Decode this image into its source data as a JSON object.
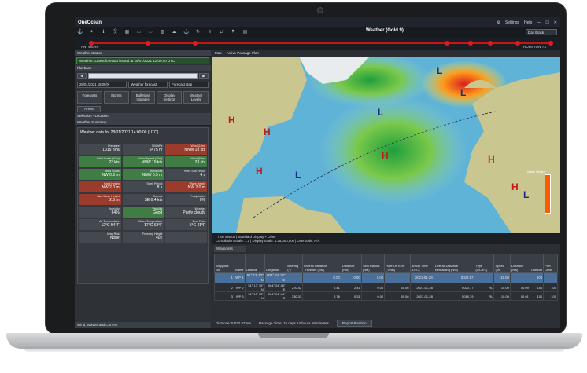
{
  "app": {
    "name": "OneOcean",
    "route_title": "Weather (Gold 9)",
    "day_select": "Day Black",
    "settings": "Settings",
    "help": "Help"
  },
  "timeline": {
    "start": "ANTWERP",
    "end": "HOUSTON TX"
  },
  "left": {
    "weather_status": "Weather Status",
    "latest_forecast": "Weather: Latest forecast issued at 28/01/2021 12:00:00 UTC",
    "playback": "Playback",
    "date_value": "28/01/2021 18:00(X",
    "weather_forecast": "Weather forecast",
    "forecast_step": "Forecast step",
    "tabs": [
      "Forecasts",
      "Storms",
      "Bulletins/ Updates",
      "Display Settings",
      "Weather Levels"
    ],
    "areas": "Areas",
    "selection": "Selection - Location",
    "summary_title": "Weather Summary",
    "weather_data_for": "Weather data for 28/01/2021 14:00:00 (UTC)",
    "wind_waves": "Wind, Waves and Current"
  },
  "summary_rows": [
    [
      {
        "label": "Pressure",
        "value": "1015 hPa",
        "c": "d"
      },
      {
        "label": "500 hPa",
        "value": "5475 m",
        "c": "d"
      },
      {
        "label": "Wind (10m)",
        "value": "NNW 18 kts",
        "c": "r"
      }
    ],
    [
      {
        "label": "Wind Gusts (10m)",
        "value": "23 kts",
        "c": "g"
      },
      {
        "label": "Wind Speed (10m)",
        "value": "NNW 19 kts",
        "c": "g"
      },
      {
        "label": "Wind (50m)",
        "value": "23 kts",
        "c": "g"
      }
    ],
    [
      {
        "label": "Wind Gusts",
        "value": "NW 0.5 m",
        "c": "g"
      },
      {
        "label": "Wind Sea",
        "value": "NNW 0.5 m",
        "c": "g"
      },
      {
        "label": "Wind Sea Period",
        "value": "4 s",
        "c": "d"
      }
    ],
    [
      {
        "label": "Swell Height",
        "value": "NW 2.0 m",
        "c": "r"
      },
      {
        "label": "Swell Period",
        "value": "8 s",
        "c": "d"
      },
      {
        "label": "Wave Height",
        "value": "NW 2.0 m",
        "c": "r"
      }
    ],
    [
      {
        "label": "Max Wave Height",
        "value": "2.5 m",
        "c": "r"
      },
      {
        "label": "Current",
        "value": "SE 0.4 kts",
        "c": "d"
      },
      {
        "label": "Precipitation",
        "value": "0%",
        "c": "d"
      }
    ],
    [
      {
        "label": "Humidity",
        "value": "64%",
        "c": "d"
      },
      {
        "label": "Visibility",
        "value": "Good",
        "c": "g"
      },
      {
        "label": "Weather",
        "value": "Partly cloudy",
        "c": "d"
      }
    ],
    [
      {
        "label": "Air Temperature",
        "value": "12°C 54°F",
        "c": "d"
      },
      {
        "label": "Water Temperature",
        "value": "17°C 63°F",
        "c": "d"
      },
      {
        "label": "Dew Point",
        "value": "5°C 41°F",
        "c": "d"
      }
    ],
    [
      {
        "label": "Icing Risk",
        "value": "None",
        "c": "d"
      },
      {
        "label": "Freezing Height",
        "value": "402",
        "c": "d"
      },
      {
        "label": "",
        "value": "",
        "c": "d"
      }
    ]
  ],
  "map": {
    "tabs": [
      "Map",
      "Active Passage Plan"
    ],
    "legend_title": "Wave Height",
    "status": "| True Motion | Standard Display + Other",
    "scale": "Compilation Scale: 1:1 | Display Scale: 1:25,000,000 | Overscale: N/A",
    "right_tools": [
      "Display",
      "ENC",
      "AIO"
    ]
  },
  "waypoints": {
    "tab": "Waypoints",
    "group": "GENERAL",
    "headers": [
      "Waypoint No.",
      "Name",
      "Latitude",
      "Longitude",
      "Bearing (°)",
      "Overall Distance Travelled (NM)",
      "Distance (NM)",
      "Turn Radius (NM)",
      "Rate Of Turn (°/min)",
      "Arrival Time (UTC)",
      "Overall Distance Remaining (NM)",
      "Type (GC/RL)",
      "Speed (kn)",
      "Duration (hrs)",
      "Corridor",
      "Port Limit"
    ],
    "rows": [
      [
        "1",
        "WP 1",
        "51° 13' 12\" N",
        "004° 24' 12\" E",
        "",
        "0.00",
        "0.00",
        "0.00",
        "",
        "2021-01-28",
        "5022.57",
        "",
        "15.00",
        "",
        "100",
        ""
      ],
      [
        "2",
        "WP 2",
        "51° 13' 15\" N",
        "004° 24' 45\" E",
        "270.42",
        "2.41",
        "2.41",
        "0.00",
        "55.56",
        "2021-01-28",
        "5020.17",
        "RL",
        "15.00",
        "00.09",
        "100",
        "100"
      ],
      [
        "3",
        "WP 3",
        "51° 13' 33\" N",
        "004° 21' 44\" E",
        "330.31",
        "2.78",
        "0.31",
        "0.00",
        "55.56",
        "2021-01-28",
        "5019.79",
        "RL",
        "15.00",
        "00.01",
        "100",
        "100"
      ]
    ],
    "distance": "Distance: 5,022.57 nm",
    "passage_time": "Passage Time: 15 days 14 hours 58 minutes",
    "report_button": "Report Position"
  }
}
